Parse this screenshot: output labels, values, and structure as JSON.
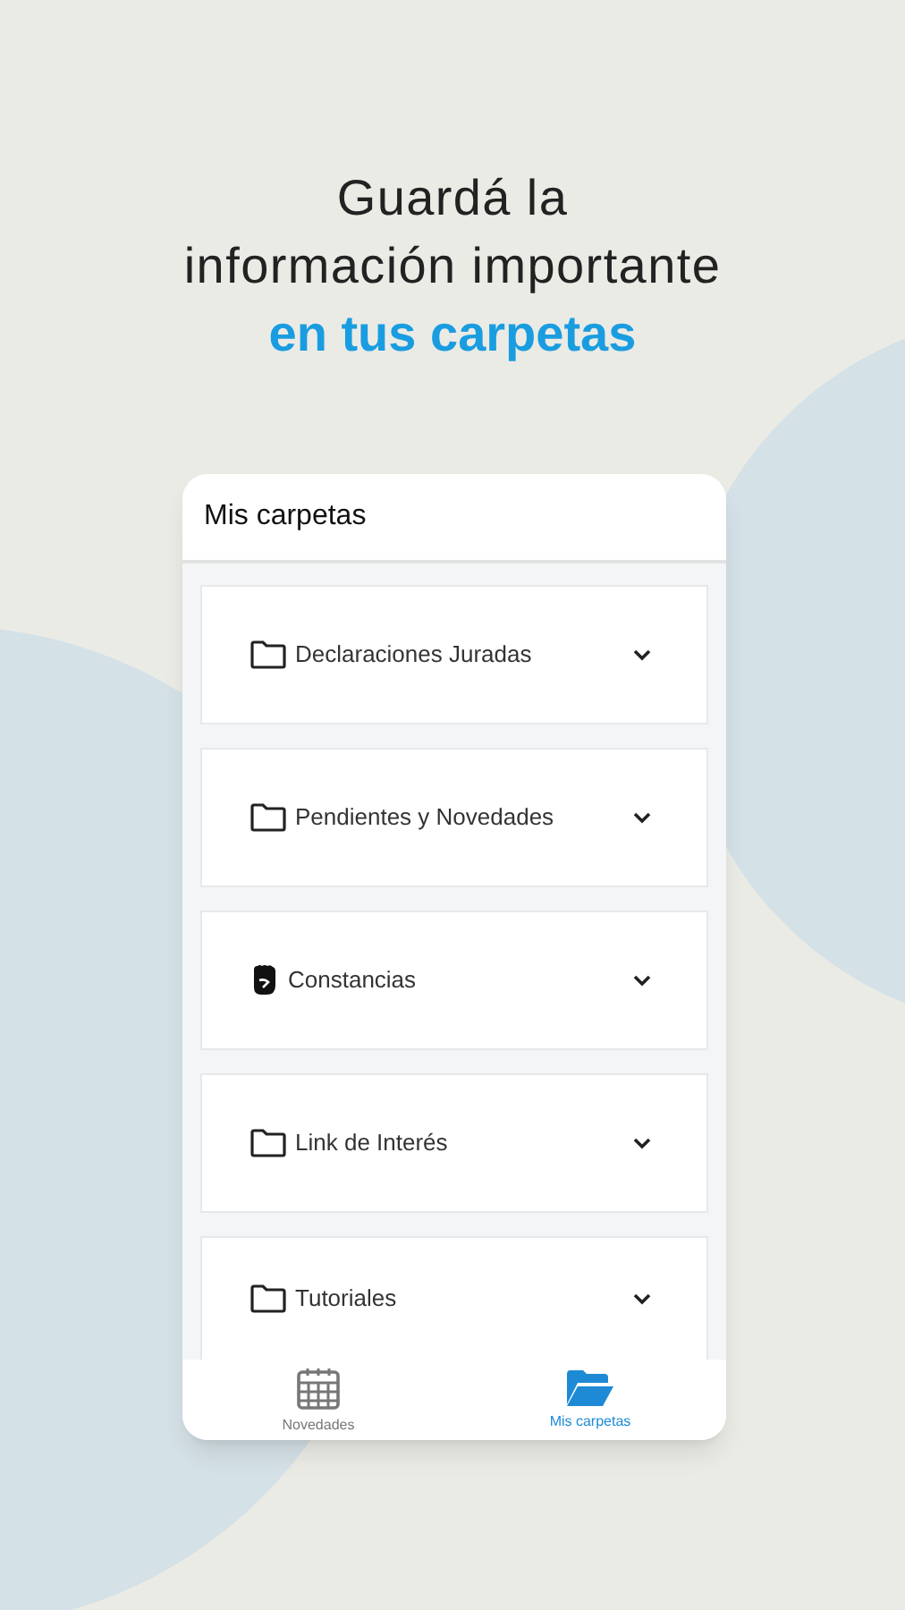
{
  "headline": {
    "lines": [
      "Guardá la",
      "información importante"
    ],
    "highlight": "en tus carpetas"
  },
  "screen": {
    "title": "Mis carpetas",
    "folders": [
      {
        "label": "Declaraciones Juradas",
        "kind": "folder",
        "expanded": false
      },
      {
        "label": "Pendientes y Novedades",
        "kind": "folder",
        "expanded": false
      },
      {
        "label": "Constancias",
        "kind": "fist",
        "expanded": false
      },
      {
        "label": "Link de Interés",
        "kind": "folder",
        "expanded": false
      },
      {
        "label": "Tutoriales",
        "kind": "folder",
        "expanded": false
      }
    ],
    "tabs": [
      {
        "label": "Novedades",
        "kind": "calendar",
        "selected": false
      },
      {
        "label": "Mis carpetas",
        "kind": "folder",
        "selected": true
      }
    ]
  }
}
